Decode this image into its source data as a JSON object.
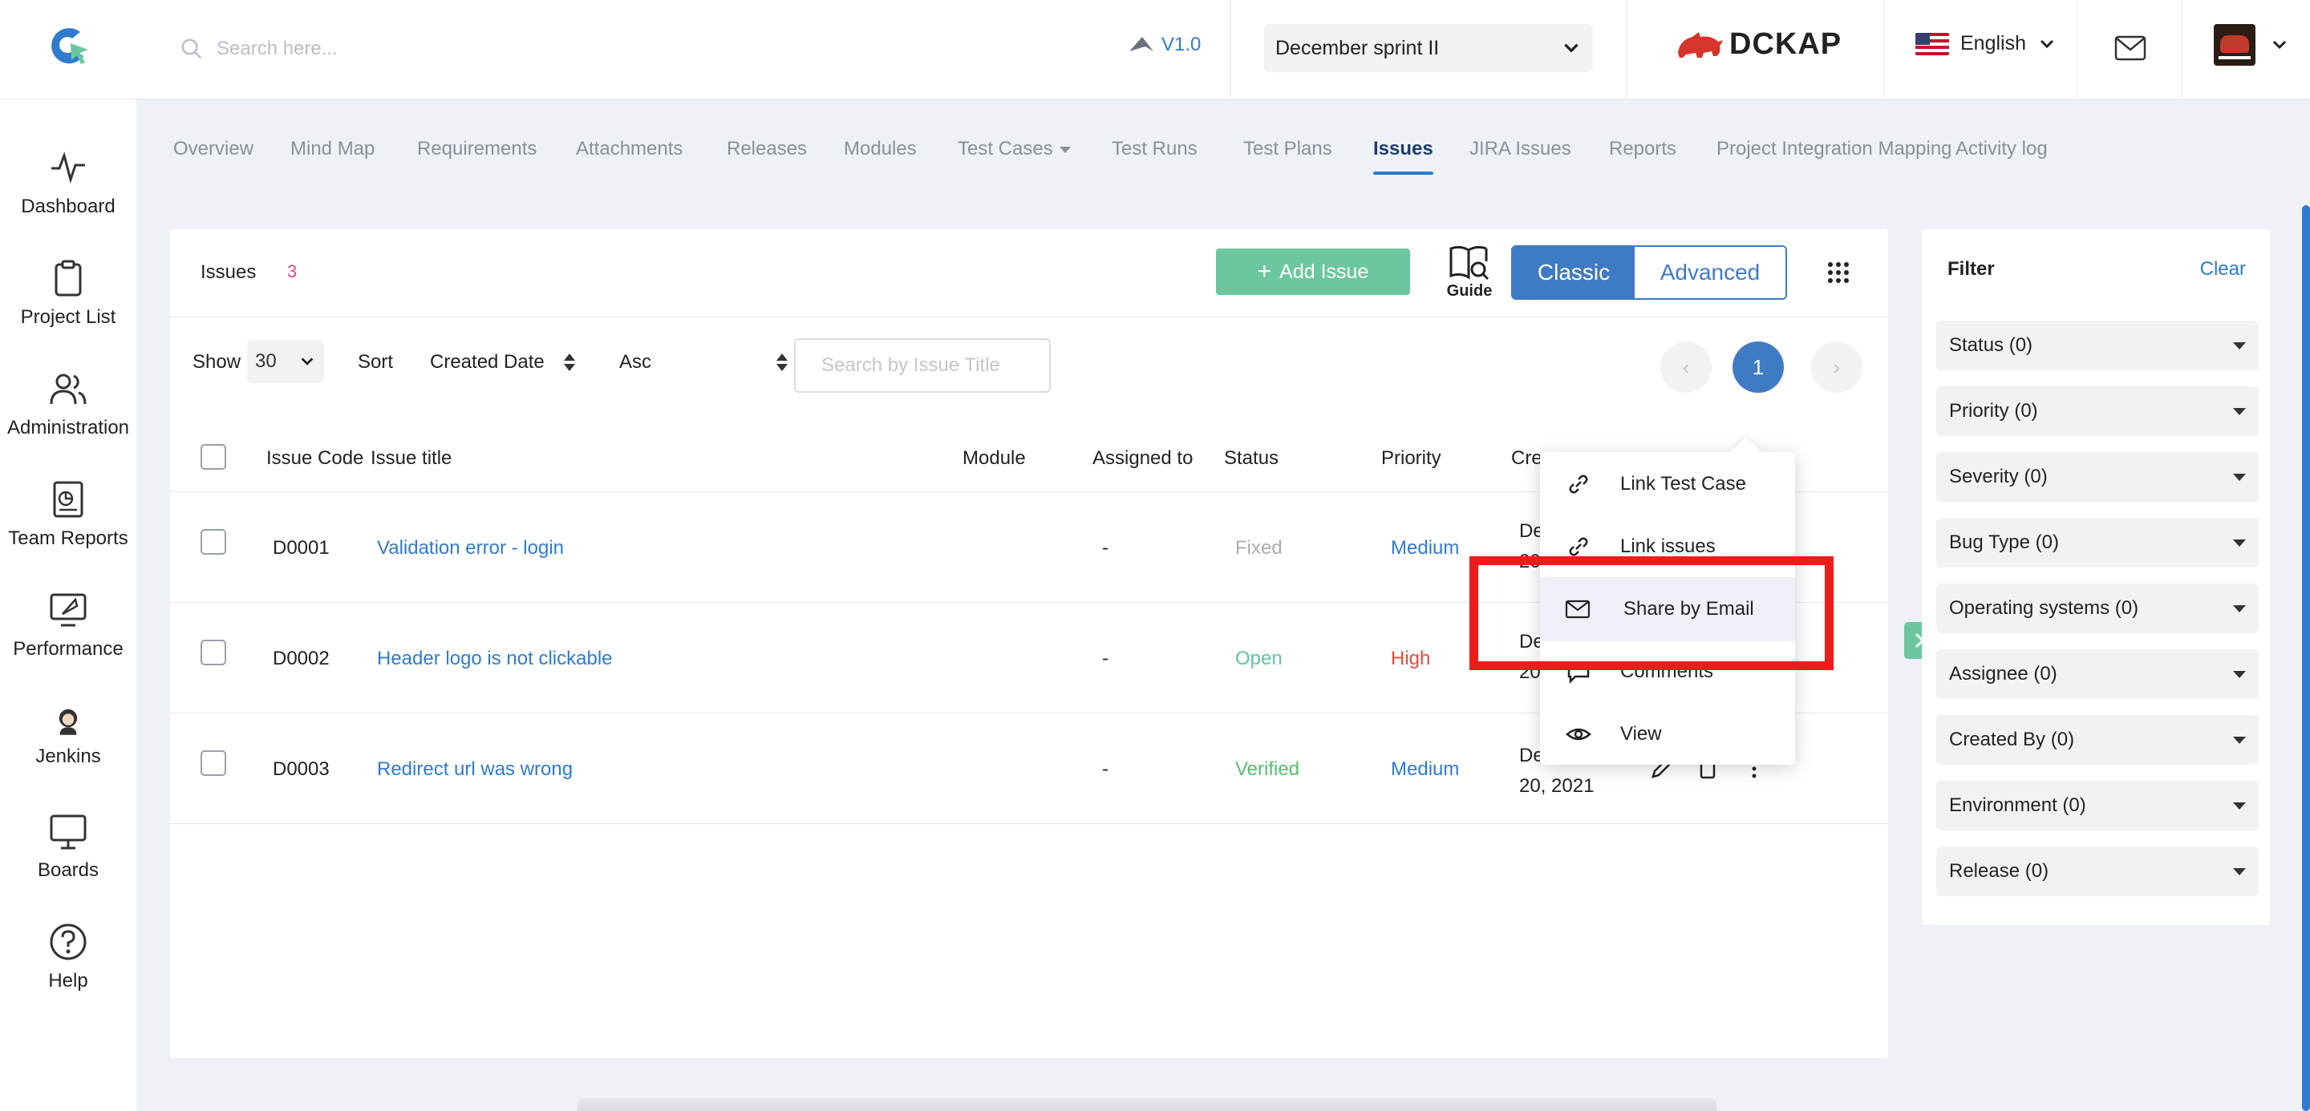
{
  "header": {
    "search_placeholder": "Search here...",
    "version": "V1.0",
    "sprint": "December sprint II",
    "brand": "DCKAP",
    "language": "English"
  },
  "nav": {
    "items": [
      {
        "label": "Dashboard"
      },
      {
        "label": "Project List"
      },
      {
        "label": "Administration"
      },
      {
        "label": "Team Reports"
      },
      {
        "label": "Performance"
      },
      {
        "label": "Jenkins"
      },
      {
        "label": "Boards"
      },
      {
        "label": "Help"
      }
    ]
  },
  "tabs": [
    {
      "label": "Overview"
    },
    {
      "label": "Mind Map"
    },
    {
      "label": "Requirements"
    },
    {
      "label": "Attachments"
    },
    {
      "label": "Releases"
    },
    {
      "label": "Modules"
    },
    {
      "label": "Test Cases"
    },
    {
      "label": "Test Runs"
    },
    {
      "label": "Test Plans"
    },
    {
      "label": "Issues"
    },
    {
      "label": "JIRA Issues"
    },
    {
      "label": "Reports"
    },
    {
      "label": "Project Integration Mapping"
    },
    {
      "label": "Activity log"
    }
  ],
  "issues": {
    "title": "Issues",
    "count": "3",
    "add_label": "Add Issue",
    "guide_label": "Guide",
    "view_classic": "Classic",
    "view_advanced": "Advanced"
  },
  "toolbar": {
    "show_label": "Show",
    "show_value": "30",
    "sort_label": "Sort",
    "sort_field": "Created Date",
    "sort_order": "Asc",
    "search_placeholder": "Search by Issue Title",
    "page_prev": "‹",
    "page_current": "1",
    "page_next": "›"
  },
  "table": {
    "headers": {
      "code": "Issue Code",
      "title": "Issue title",
      "module": "Module",
      "assigned": "Assigned to",
      "status": "Status",
      "priority": "Priority",
      "created": "Cre"
    },
    "rows": [
      {
        "code": "D0001",
        "title": "Validation error - login",
        "assigned": "-",
        "status": "Fixed",
        "status_color": "#a8adb4",
        "priority": "Medium",
        "priority_color": "#2e7bd1",
        "created_1": "De",
        "created_2": "20"
      },
      {
        "code": "D0002",
        "title": "Header logo is not clickable",
        "assigned": "-",
        "status": "Open",
        "status_color": "#5fc3a0",
        "priority": "High",
        "priority_color": "#e04b3a",
        "created_1": "De",
        "created_2": "20"
      },
      {
        "code": "D0003",
        "title": "Redirect url was wrong",
        "assigned": "-",
        "status": "Verified",
        "status_color": "#52c16a",
        "priority": "Medium",
        "priority_color": "#2e7bd1",
        "created_1": "De",
        "created_2": "20, 2021"
      }
    ]
  },
  "menu": {
    "items": [
      {
        "label": "Link Test Case",
        "icon": "link-icon"
      },
      {
        "label": "Link issues",
        "icon": "link-icon"
      },
      {
        "label": "Share by Email",
        "icon": "mail-icon"
      },
      {
        "label": "Comments",
        "icon": "comment-icon"
      },
      {
        "label": "View",
        "icon": "eye-icon"
      }
    ]
  },
  "filter": {
    "title": "Filter",
    "clear": "Clear",
    "items": [
      {
        "label": "Status (0)"
      },
      {
        "label": "Priority (0)"
      },
      {
        "label": "Severity (0)"
      },
      {
        "label": "Bug Type (0)"
      },
      {
        "label": "Operating systems (0)"
      },
      {
        "label": "Assignee (0)"
      },
      {
        "label": "Created By (0)"
      },
      {
        "label": "Environment (0)"
      },
      {
        "label": "Release (0)"
      }
    ]
  },
  "colors": {
    "accent": "#3f7bc4",
    "link": "#2e7bd1",
    "add_button": "#6cc7a0",
    "highlight_box": "#ee1b1b"
  }
}
